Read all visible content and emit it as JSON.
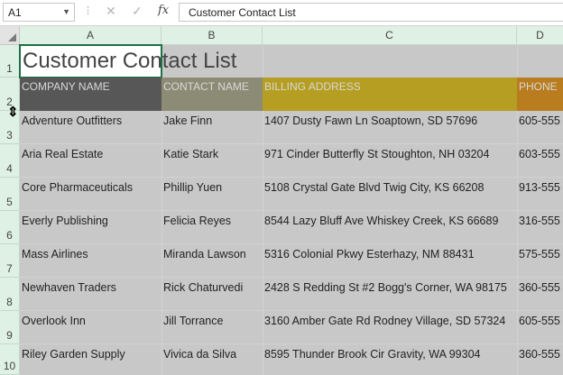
{
  "formula_bar": {
    "name_box": "A1",
    "formula": "Customer Contact List"
  },
  "columns": [
    "A",
    "B",
    "C",
    "D"
  ],
  "rows": [
    "1",
    "2",
    "3",
    "4",
    "5",
    "6",
    "7",
    "8",
    "9",
    "10"
  ],
  "sheet": {
    "title": "Customer Contact List",
    "headers": [
      "COMPANY NAME",
      "CONTACT NAME",
      "BILLING ADDRESS",
      "PHONE"
    ],
    "records": [
      {
        "company": "Adventure Outfitters",
        "contact": "Jake Finn",
        "address": "1407 Dusty Fawn Ln Soaptown, SD 57696",
        "phone": "605-555"
      },
      {
        "company": "Aria Real Estate",
        "contact": "Katie Stark",
        "address": "971 Cinder Butterfly St Stoughton, NH 03204",
        "phone": "603-555"
      },
      {
        "company": "Core Pharmaceuticals",
        "contact": "Phillip Yuen",
        "address": "5108 Crystal Gate Blvd Twig City, KS 66208",
        "phone": "913-555"
      },
      {
        "company": "Everly Publishing",
        "contact": "Felicia Reyes",
        "address": "8544 Lazy Bluff Ave Whiskey Creek, KS 66689",
        "phone": "316-555"
      },
      {
        "company": "Mass Airlines",
        "contact": "Miranda Lawson",
        "address": "5316 Colonial Pkwy Esterhazy, NM 88431",
        "phone": "575-555"
      },
      {
        "company": "Newhaven Traders",
        "contact": "Rick Chaturvedi",
        "address": "2428 S Redding St #2 Bogg's Corner, WA 98175",
        "phone": "360-555"
      },
      {
        "company": "Overlook Inn",
        "contact": "Jill Torrance",
        "address": "3160 Amber Gate Rd Rodney Village, SD 57324",
        "phone": "605-555"
      },
      {
        "company": "Riley Garden Supply",
        "contact": "Vivica da Silva",
        "address": "8595 Thunder Brook Cir Gravity, WA 99304",
        "phone": "360-555"
      }
    ]
  },
  "colors": {
    "header_company": "#575757",
    "header_contact": "#8c8c76",
    "header_billing": "#b59e22",
    "header_phone": "#b97c1e",
    "selection": "#1e7145"
  },
  "icons": {
    "cancel": "cancel-icon",
    "enter": "enter-icon",
    "function": "fx-icon",
    "resize_cursor": "row-resize-cursor-icon"
  }
}
